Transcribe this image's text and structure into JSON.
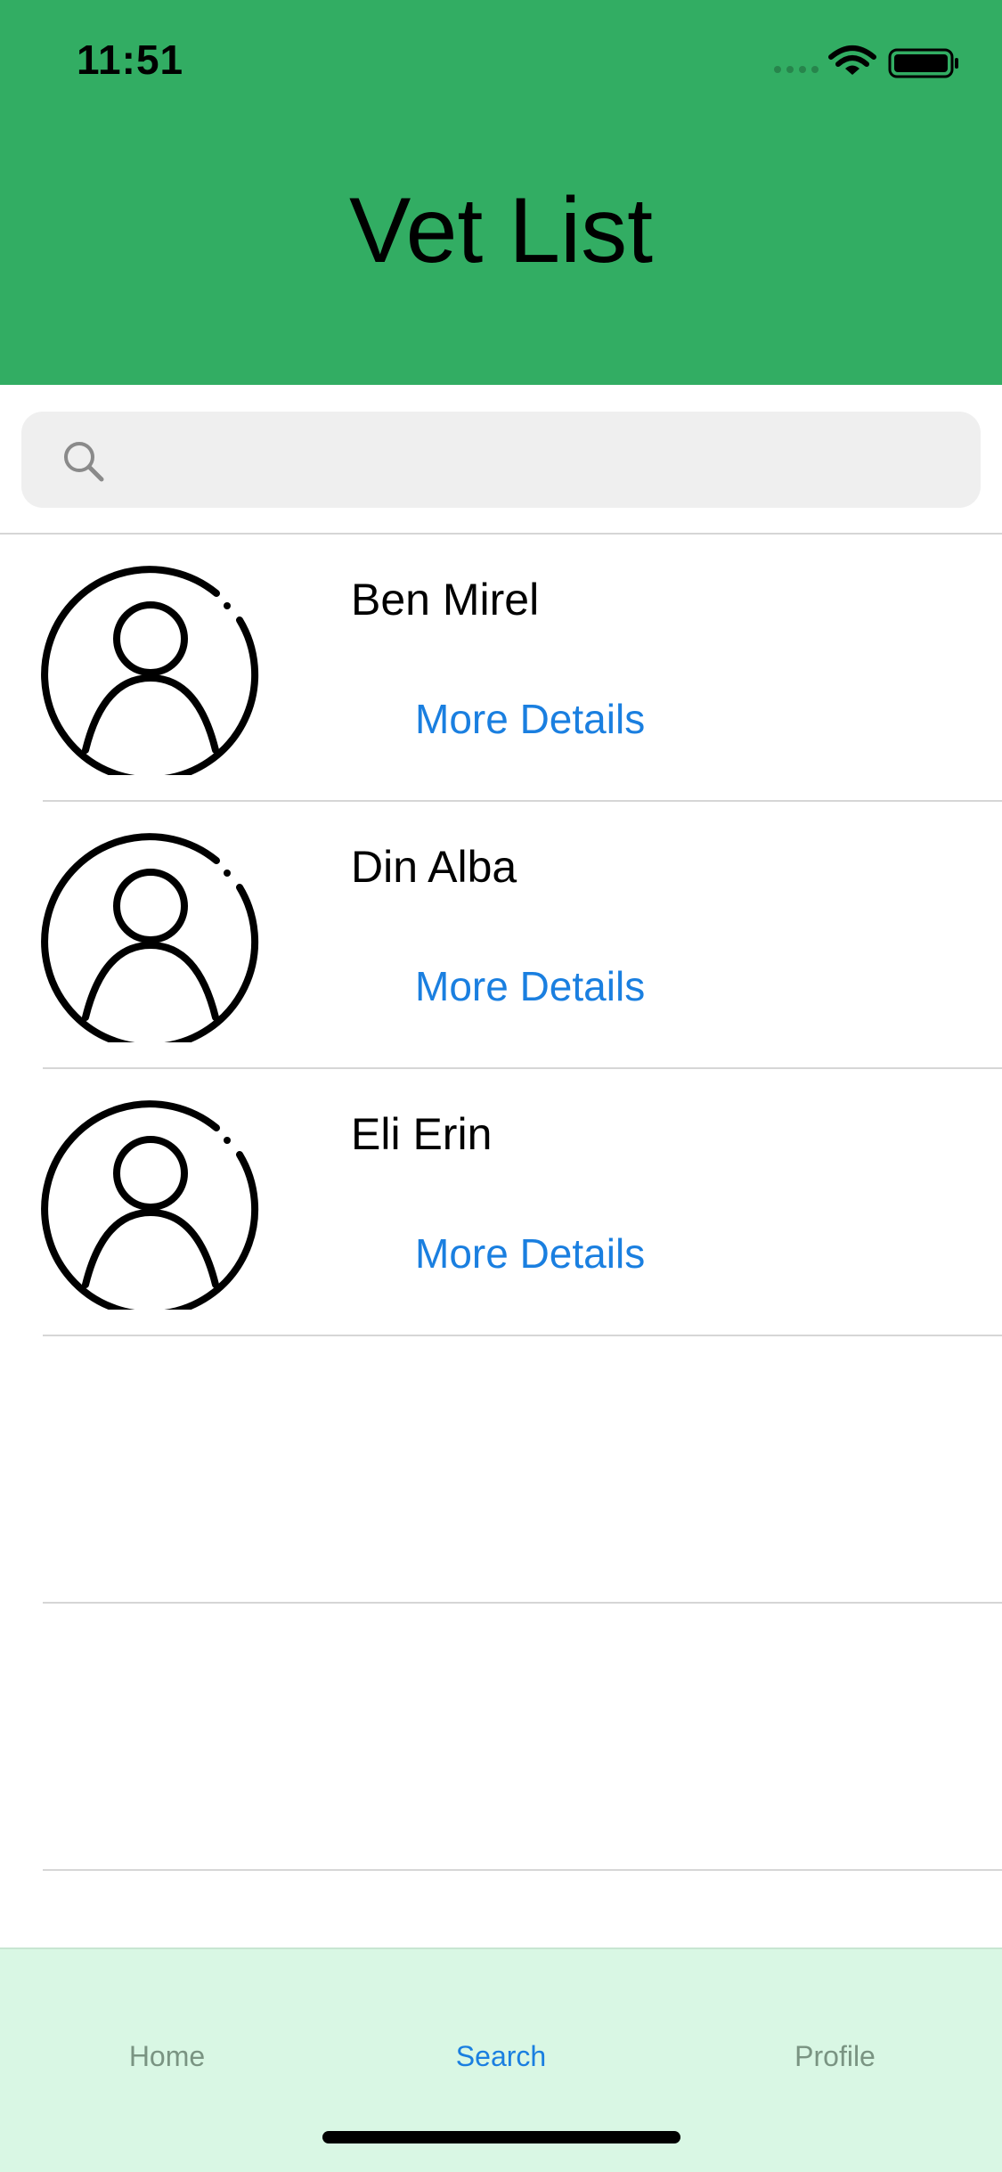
{
  "status_bar": {
    "time": "11:51",
    "icons": [
      "signal-icon",
      "wifi-icon",
      "battery-icon"
    ]
  },
  "header": {
    "title": "Vet List",
    "background_color": "#32ad63"
  },
  "search": {
    "placeholder": "",
    "value": "",
    "icon": "search-icon"
  },
  "vets": [
    {
      "name": "Ben Mirel",
      "link_label": "More Details",
      "avatar_icon": "user-avatar-icon"
    },
    {
      "name": "Din Alba",
      "link_label": "More Details",
      "avatar_icon": "user-avatar-icon"
    },
    {
      "name": "Eli Erin",
      "link_label": "More Details",
      "avatar_icon": "user-avatar-icon"
    }
  ],
  "tab_bar": {
    "background_color": "#d9f7e4",
    "active_color": "#1a7fe0",
    "tabs": [
      {
        "label": "Home"
      },
      {
        "label": "Search"
      },
      {
        "label": "Profile"
      }
    ],
    "active_tab": "Search"
  }
}
